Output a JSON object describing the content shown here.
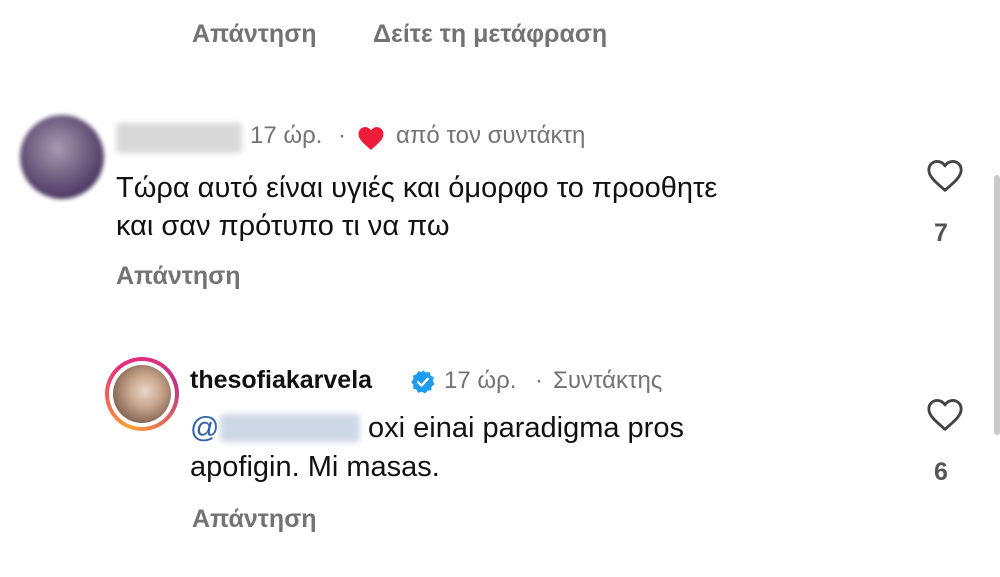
{
  "top_actions": {
    "reply": "Απάντηση",
    "translate": "Δείτε τη μετάφραση"
  },
  "comment1": {
    "time": "17 ώρ.",
    "dot": "·",
    "liked_by_author": "από τον συντάκτη",
    "text_line1": "Τώρα αυτό είναι υγιές και όμορφο το προοθητε",
    "text_line2": "και σαν πρότυπο τι να πω",
    "reply": "Απάντηση",
    "like_count": "7"
  },
  "comment2": {
    "username": "thesofiakarvela",
    "time": "17 ώρ.",
    "dot": "·",
    "role": "Συντάκτης",
    "mention": "@",
    "text_line1_rest": "oxi einai paradigma pros",
    "text_line2": "apofigin. Mi masas.",
    "reply": "Απάντηση",
    "like_count": "6"
  },
  "colors": {
    "heart_red": "#ed1c3a",
    "verified_blue": "#1d9bf0",
    "mention_blue": "#2f5fa8",
    "muted_gray": "#737373"
  },
  "icons": [
    "heart-filled-icon",
    "heart-outline-icon",
    "verified-badge-icon"
  ]
}
